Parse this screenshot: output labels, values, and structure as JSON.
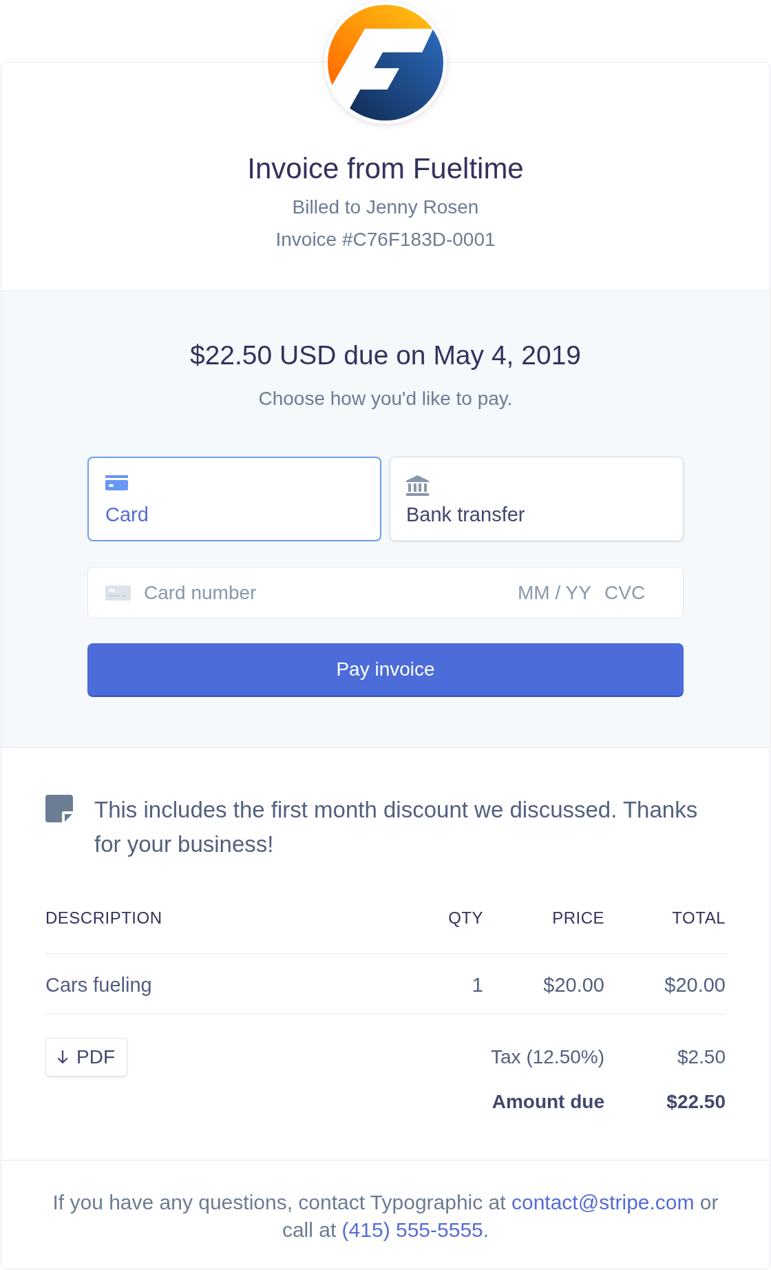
{
  "header": {
    "title": "Invoice from Fueltime",
    "billed_to": "Billed to Jenny Rosen",
    "invoice_number": "Invoice #C76F183D-0001"
  },
  "payment": {
    "heading": "$22.50 USD due on May 4, 2019",
    "prompt": "Choose how you'd like to pay.",
    "methods": [
      {
        "kind": "card",
        "label": "Card",
        "selected": true
      },
      {
        "kind": "bank",
        "label": "Bank transfer",
        "selected": false
      }
    ],
    "card_fields": {
      "number_placeholder": "Card number",
      "expiry_placeholder": "MM / YY",
      "cvc_placeholder": "CVC"
    },
    "pay_button": "Pay invoice"
  },
  "memo": "This includes the first month discount we discussed. Thanks for your business!",
  "line_items": {
    "columns": [
      "DESCRIPTION",
      "QTY",
      "PRICE",
      "TOTAL"
    ],
    "rows": [
      [
        "Cars fueling",
        "1",
        "$20.00",
        "$20.00"
      ]
    ]
  },
  "download_button": "PDF",
  "summary": [
    {
      "label": "Tax (12.50%)",
      "value": "$2.50",
      "emphasis": false
    },
    {
      "label": "Amount due",
      "value": "$22.50",
      "emphasis": true
    }
  ],
  "footer": [
    {
      "kind": "text",
      "text": "If you have any questions, contact Typographic at "
    },
    {
      "kind": "link",
      "text": "contact@stripe.com"
    },
    {
      "kind": "text",
      "text": " or call at "
    },
    {
      "kind": "link",
      "text": "(415) 555-5555"
    },
    {
      "kind": "text",
      "text": "."
    }
  ]
}
